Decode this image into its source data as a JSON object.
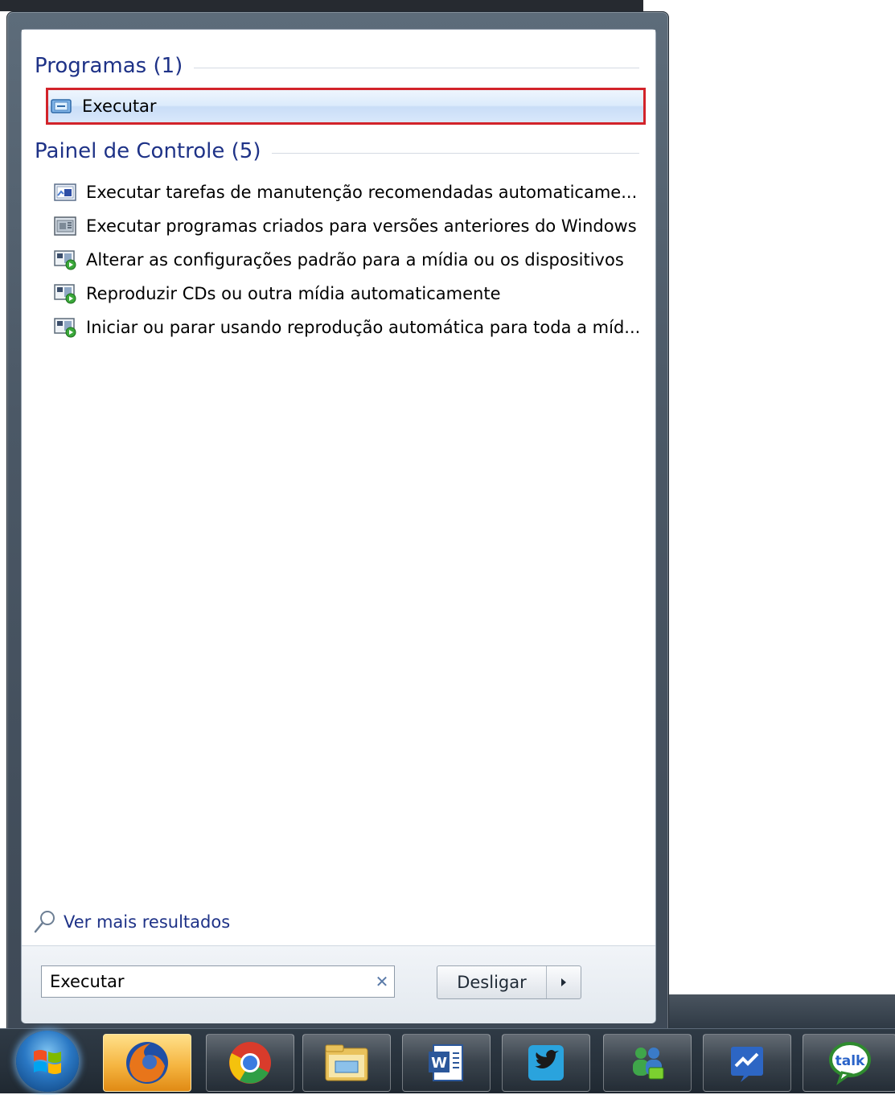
{
  "start_menu": {
    "groups": [
      {
        "title": "Programas (1)",
        "items": [
          {
            "label": "Executar",
            "icon": "run-icon",
            "selected": true
          }
        ]
      },
      {
        "title": "Painel de Controle (5)",
        "items": [
          {
            "label": "Executar tarefas de manutenção recomendadas automaticame...",
            "icon": "maintenance-icon"
          },
          {
            "label": "Executar programas criados para versões anteriores do Windows",
            "icon": "compatibility-icon"
          },
          {
            "label": "Alterar as configurações padrão para a mídia ou os dispositivos",
            "icon": "autoplay-icon"
          },
          {
            "label": "Reproduzir CDs ou outra mídia automaticamente",
            "icon": "autoplay-icon"
          },
          {
            "label": "Iniciar ou parar usando reprodução automática para toda a míd...",
            "icon": "autoplay-icon"
          }
        ]
      }
    ],
    "see_more": "Ver mais resultados",
    "search": {
      "value": "Executar",
      "clear_icon": "clear-icon"
    },
    "shutdown": {
      "label": "Desligar",
      "arrow_icon": "chevron-right-icon"
    }
  },
  "taskbar": {
    "start_icon": "windows-start-orb",
    "apps": [
      {
        "name": "firefox",
        "icon": "firefox-icon",
        "active": true
      },
      {
        "name": "chrome",
        "icon": "chrome-icon"
      },
      {
        "name": "windows-explorer",
        "icon": "folder-icon"
      },
      {
        "name": "word",
        "icon": "word-icon"
      },
      {
        "name": "twitter",
        "icon": "twitter-icon"
      },
      {
        "name": "messenger",
        "icon": "messenger-icon"
      },
      {
        "name": "pulse",
        "icon": "activity-icon"
      },
      {
        "name": "gtalk",
        "icon": "talk-icon"
      }
    ],
    "talk_label": "talk"
  },
  "colors": {
    "group_title": "#1e3287",
    "selection_border": "#d2232a",
    "taskbar": "#27313b"
  }
}
